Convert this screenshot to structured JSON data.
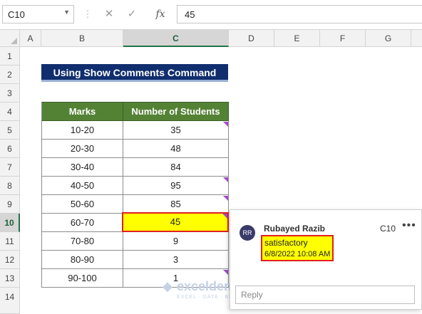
{
  "formula_bar": {
    "name_box": "C10",
    "formula": "45",
    "cancel_glyph": "✕",
    "enter_glyph": "✓",
    "fx_glyph": "fx"
  },
  "columns": [
    "A",
    "B",
    "C",
    "D",
    "E",
    "F",
    "G"
  ],
  "rows": [
    "1",
    "2",
    "3",
    "4",
    "5",
    "6",
    "7",
    "8",
    "9",
    "10",
    "11",
    "12",
    "13",
    "14"
  ],
  "title": "Using Show Comments Command",
  "table": {
    "headers": [
      "Marks",
      "Number of Students"
    ],
    "rows": [
      {
        "marks": "10-20",
        "students": "35"
      },
      {
        "marks": "20-30",
        "students": "48"
      },
      {
        "marks": "30-40",
        "students": "84"
      },
      {
        "marks": "40-50",
        "students": "95"
      },
      {
        "marks": "50-60",
        "students": "85"
      },
      {
        "marks": "60-70",
        "students": "45"
      },
      {
        "marks": "70-80",
        "students": "9"
      },
      {
        "marks": "80-90",
        "students": "3"
      },
      {
        "marks": "90-100",
        "students": "1"
      }
    ]
  },
  "comment": {
    "avatar": "RR",
    "author": "Rubayed Razib",
    "cell": "C10",
    "more": "•••",
    "text": "satisfactory",
    "timestamp": "6/8/2022 10:08 AM",
    "reply_placeholder": "Reply"
  },
  "watermark": {
    "name": "exceldemy",
    "tagline": "EXCEL · DATA · BI"
  },
  "colors": {
    "title_bg": "#102e6e",
    "header_bg": "#548235",
    "highlight": "#ffff00",
    "outline": "#e02020",
    "comment_marker": "#a64ac9"
  }
}
